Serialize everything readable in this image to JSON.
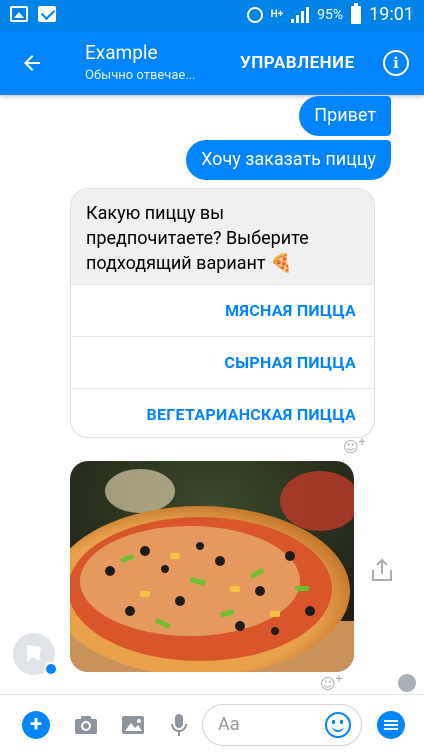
{
  "status_bar": {
    "network": "H+",
    "battery": "95%",
    "time": "19:01"
  },
  "header": {
    "title": "Example",
    "subtitle": "Обычно отвечае...",
    "manage_label": "УПРАВЛЕНИЕ"
  },
  "messages": {
    "out": [
      "Привет",
      "Хочу заказать пиццу"
    ],
    "card": {
      "text": "Какую пиццу вы предпочитаете? Выберите подходящий вариант 🍕",
      "options": [
        "МЯСНАЯ ПИЦЦА",
        "СЫРНАЯ ПИЦЦА",
        "ВЕГЕТАРИАНСКАЯ ПИЦЦА"
      ]
    },
    "image_icon": "pizza-photo"
  },
  "composer": {
    "placeholder": "Aa"
  },
  "colors": {
    "accent": "#0084ff",
    "statusbar": "#0083e8",
    "incoming_bubble": "#f1f0f0"
  }
}
